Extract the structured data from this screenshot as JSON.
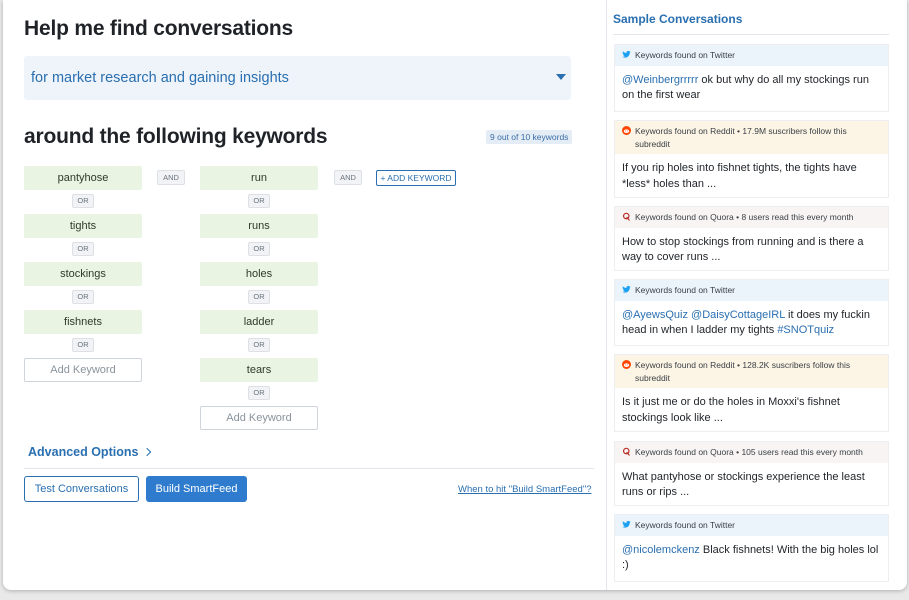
{
  "builder": {
    "title": "Help me find conversations",
    "purpose": "for market research and gaining insights",
    "keywords_heading": "around the following keywords",
    "keyword_count": "9 out of 10 keywords",
    "and_label": "AND",
    "or_label": "OR",
    "add_keyword_placeholder": "Add Keyword",
    "add_keyword_group_button": "+ ADD KEYWORD",
    "groups": [
      {
        "keywords": [
          "pantyhose",
          "tights",
          "stockings",
          "fishnets"
        ]
      },
      {
        "keywords": [
          "run",
          "runs",
          "holes",
          "ladder",
          "tears"
        ]
      }
    ],
    "advanced_options": "Advanced Options",
    "test_button": "Test Conversations",
    "build_button": "Build SmartFeed",
    "when_link": "When to hit \"Build SmartFeed\"?"
  },
  "samples": {
    "title": "Sample Conversations",
    "items": [
      {
        "source": "twitter",
        "header": "Keywords found on Twitter",
        "handle": "@Weinbergrrrrr",
        "text": " ok but why do all my stockings run on the first wear"
      },
      {
        "source": "reddit",
        "header": "Keywords found on Reddit • 17.9M suscribers follow this subreddit",
        "text": "If you rip holes into fishnet tights, the tights have *less* holes than ..."
      },
      {
        "source": "quora",
        "header": "Keywords found on Quora • 8 users read this every month",
        "text": "How to stop stockings from running and is there a way to cover runs ..."
      },
      {
        "source": "twitter",
        "header": "Keywords found on Twitter",
        "handle": "@AyewsQuiz",
        "handle2": "@DaisyCottageIRL",
        "text": " it does my fuckin head in when I ladder my tights ",
        "hashtag": "#SNOTquiz"
      },
      {
        "source": "reddit",
        "header": "Keywords found on Reddit • 128.2K suscribers follow this subreddit",
        "text": "Is it just me or do the holes in Moxxi's fishnet stockings look like ..."
      },
      {
        "source": "quora",
        "header": "Keywords found on Quora • 105 users read this every month",
        "text": "What pantyhose or stockings experience the least runs or rips ..."
      },
      {
        "source": "twitter",
        "header": "Keywords found on Twitter",
        "handle": "@nicolemckenz",
        "text": " Black fishnets! With the big holes lol :)"
      }
    ]
  },
  "colors": {
    "accent": "#2a6fb0",
    "keyword_bg": "#e9f4e3",
    "build_button": "#2f7ccf",
    "twitter": "#1da1f2",
    "reddit": "#ff4500",
    "quora": "#b92b27"
  }
}
